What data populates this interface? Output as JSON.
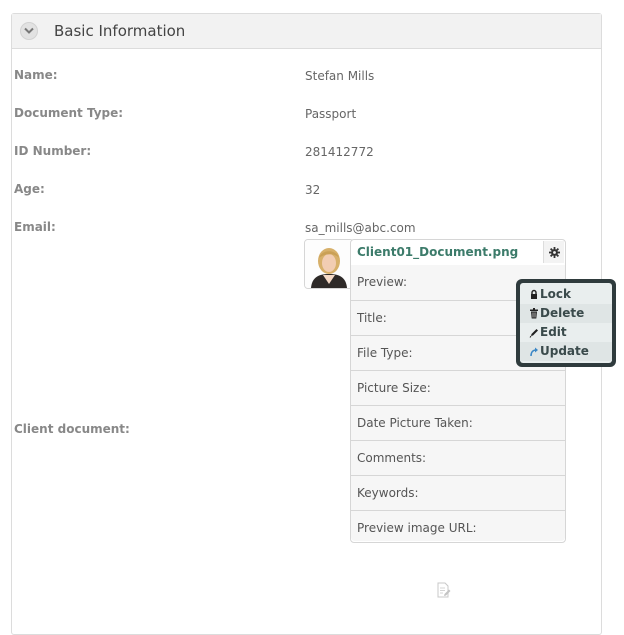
{
  "panel": {
    "title": "Basic Information",
    "toggle_icon": "chevron-down-icon"
  },
  "fields": [
    {
      "label": "Name:",
      "value": "Stefan Mills"
    },
    {
      "label": "Document Type:",
      "value": "Passport"
    },
    {
      "label": "ID Number:",
      "value": "281412772"
    },
    {
      "label": "Age:",
      "value": "32"
    },
    {
      "label": "Email:",
      "value": "sa_mills@abc.com"
    }
  ],
  "client_document": {
    "label": "Client document:",
    "filename": "Client01_Document.png",
    "thumbnail_icon": "user-photo-icon",
    "settings_icon": "gear-icon",
    "properties": [
      "Preview:",
      "Title:",
      "File Type:",
      "Picture Size:",
      "Date Picture Taken:",
      "Comments:",
      "Keywords:",
      "Preview image URL:"
    ]
  },
  "context_menu": {
    "items": [
      {
        "label": "Lock",
        "icon": "lock-icon"
      },
      {
        "label": "Delete",
        "icon": "trash-icon"
      },
      {
        "label": "Edit",
        "icon": "pencil-icon"
      },
      {
        "label": "Update",
        "icon": "update-arrow-icon"
      }
    ]
  },
  "footer": {
    "icon": "document-edit-icon"
  },
  "colors": {
    "filename": "#3c7b6a",
    "menu_frame": "#2f3b3d",
    "update_icon": "#3b87c6"
  }
}
